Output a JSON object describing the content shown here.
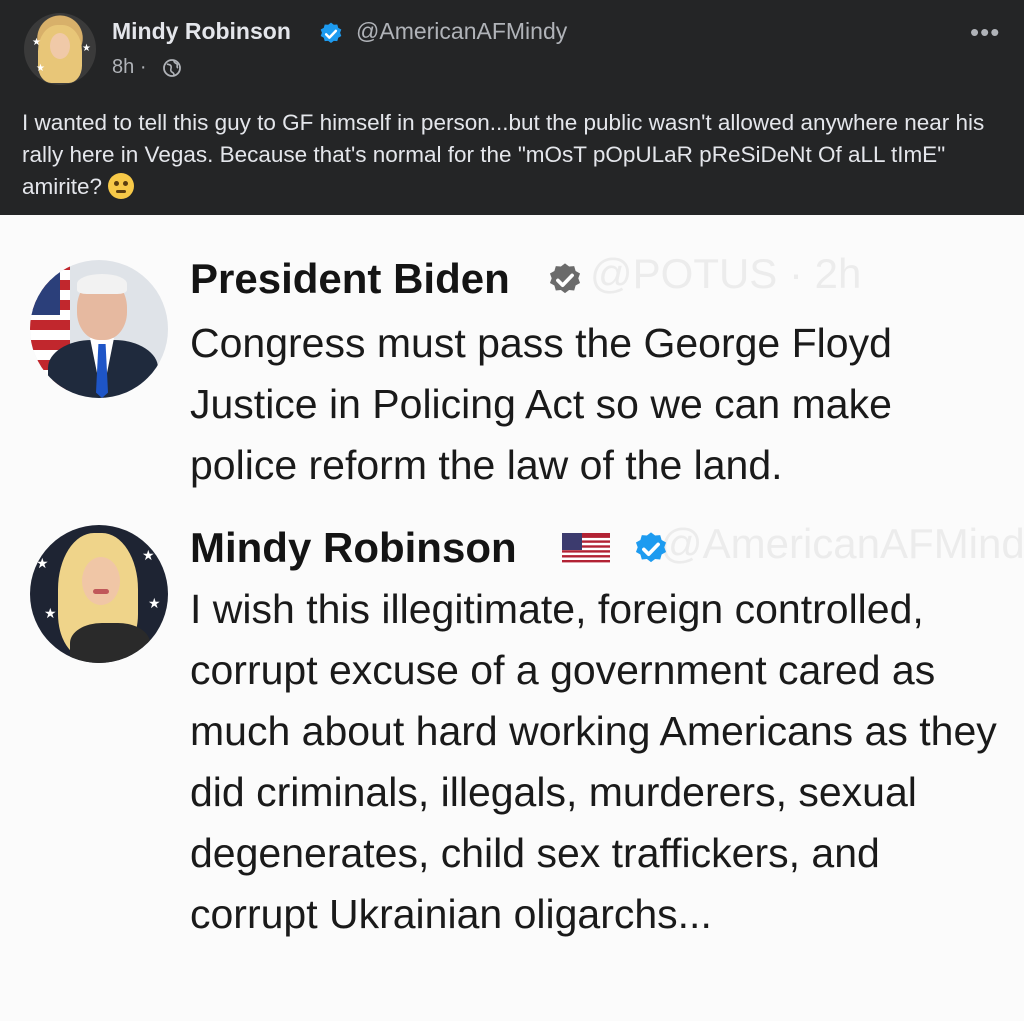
{
  "post": {
    "author": "Mindy Robinson",
    "handle": "@AmericanAFMindy",
    "time": "8h",
    "separator": "·",
    "more": "•••",
    "text": "I wanted to tell this guy to GF himself in person...but the public wasn't allowed anywhere near his rally here in Vegas. Because that's normal for the \"mOsT pOpULaR pReSiDeNt Of aLL tImE\" amirite?"
  },
  "tweets": [
    {
      "name": "President Biden",
      "body": "Congress must pass the George Floyd Justice in Policing Act so we can make police reform the law of the land.",
      "badge_color": "#6b6b6b"
    },
    {
      "name": "Mindy Robinson",
      "body": "I wish this illegitimate, foreign controlled, corrupt excuse of a government cared as much about hard working Americans as they did criminals, illegals, murderers, sexual degenerates, child sex traffickers, and corrupt Ukrainian oligarchs...",
      "badge_color": "#1d9bf0"
    }
  ],
  "colors": {
    "background": "#242526",
    "primary_text": "#e4e6eb",
    "secondary_text": "#b0b3b8",
    "verified": "#1d9bf0"
  },
  "icons": [
    "verified-badge-icon",
    "globe-icon",
    "more-options-icon",
    "eye-roll-emoji-icon",
    "us-flag-icon"
  ]
}
